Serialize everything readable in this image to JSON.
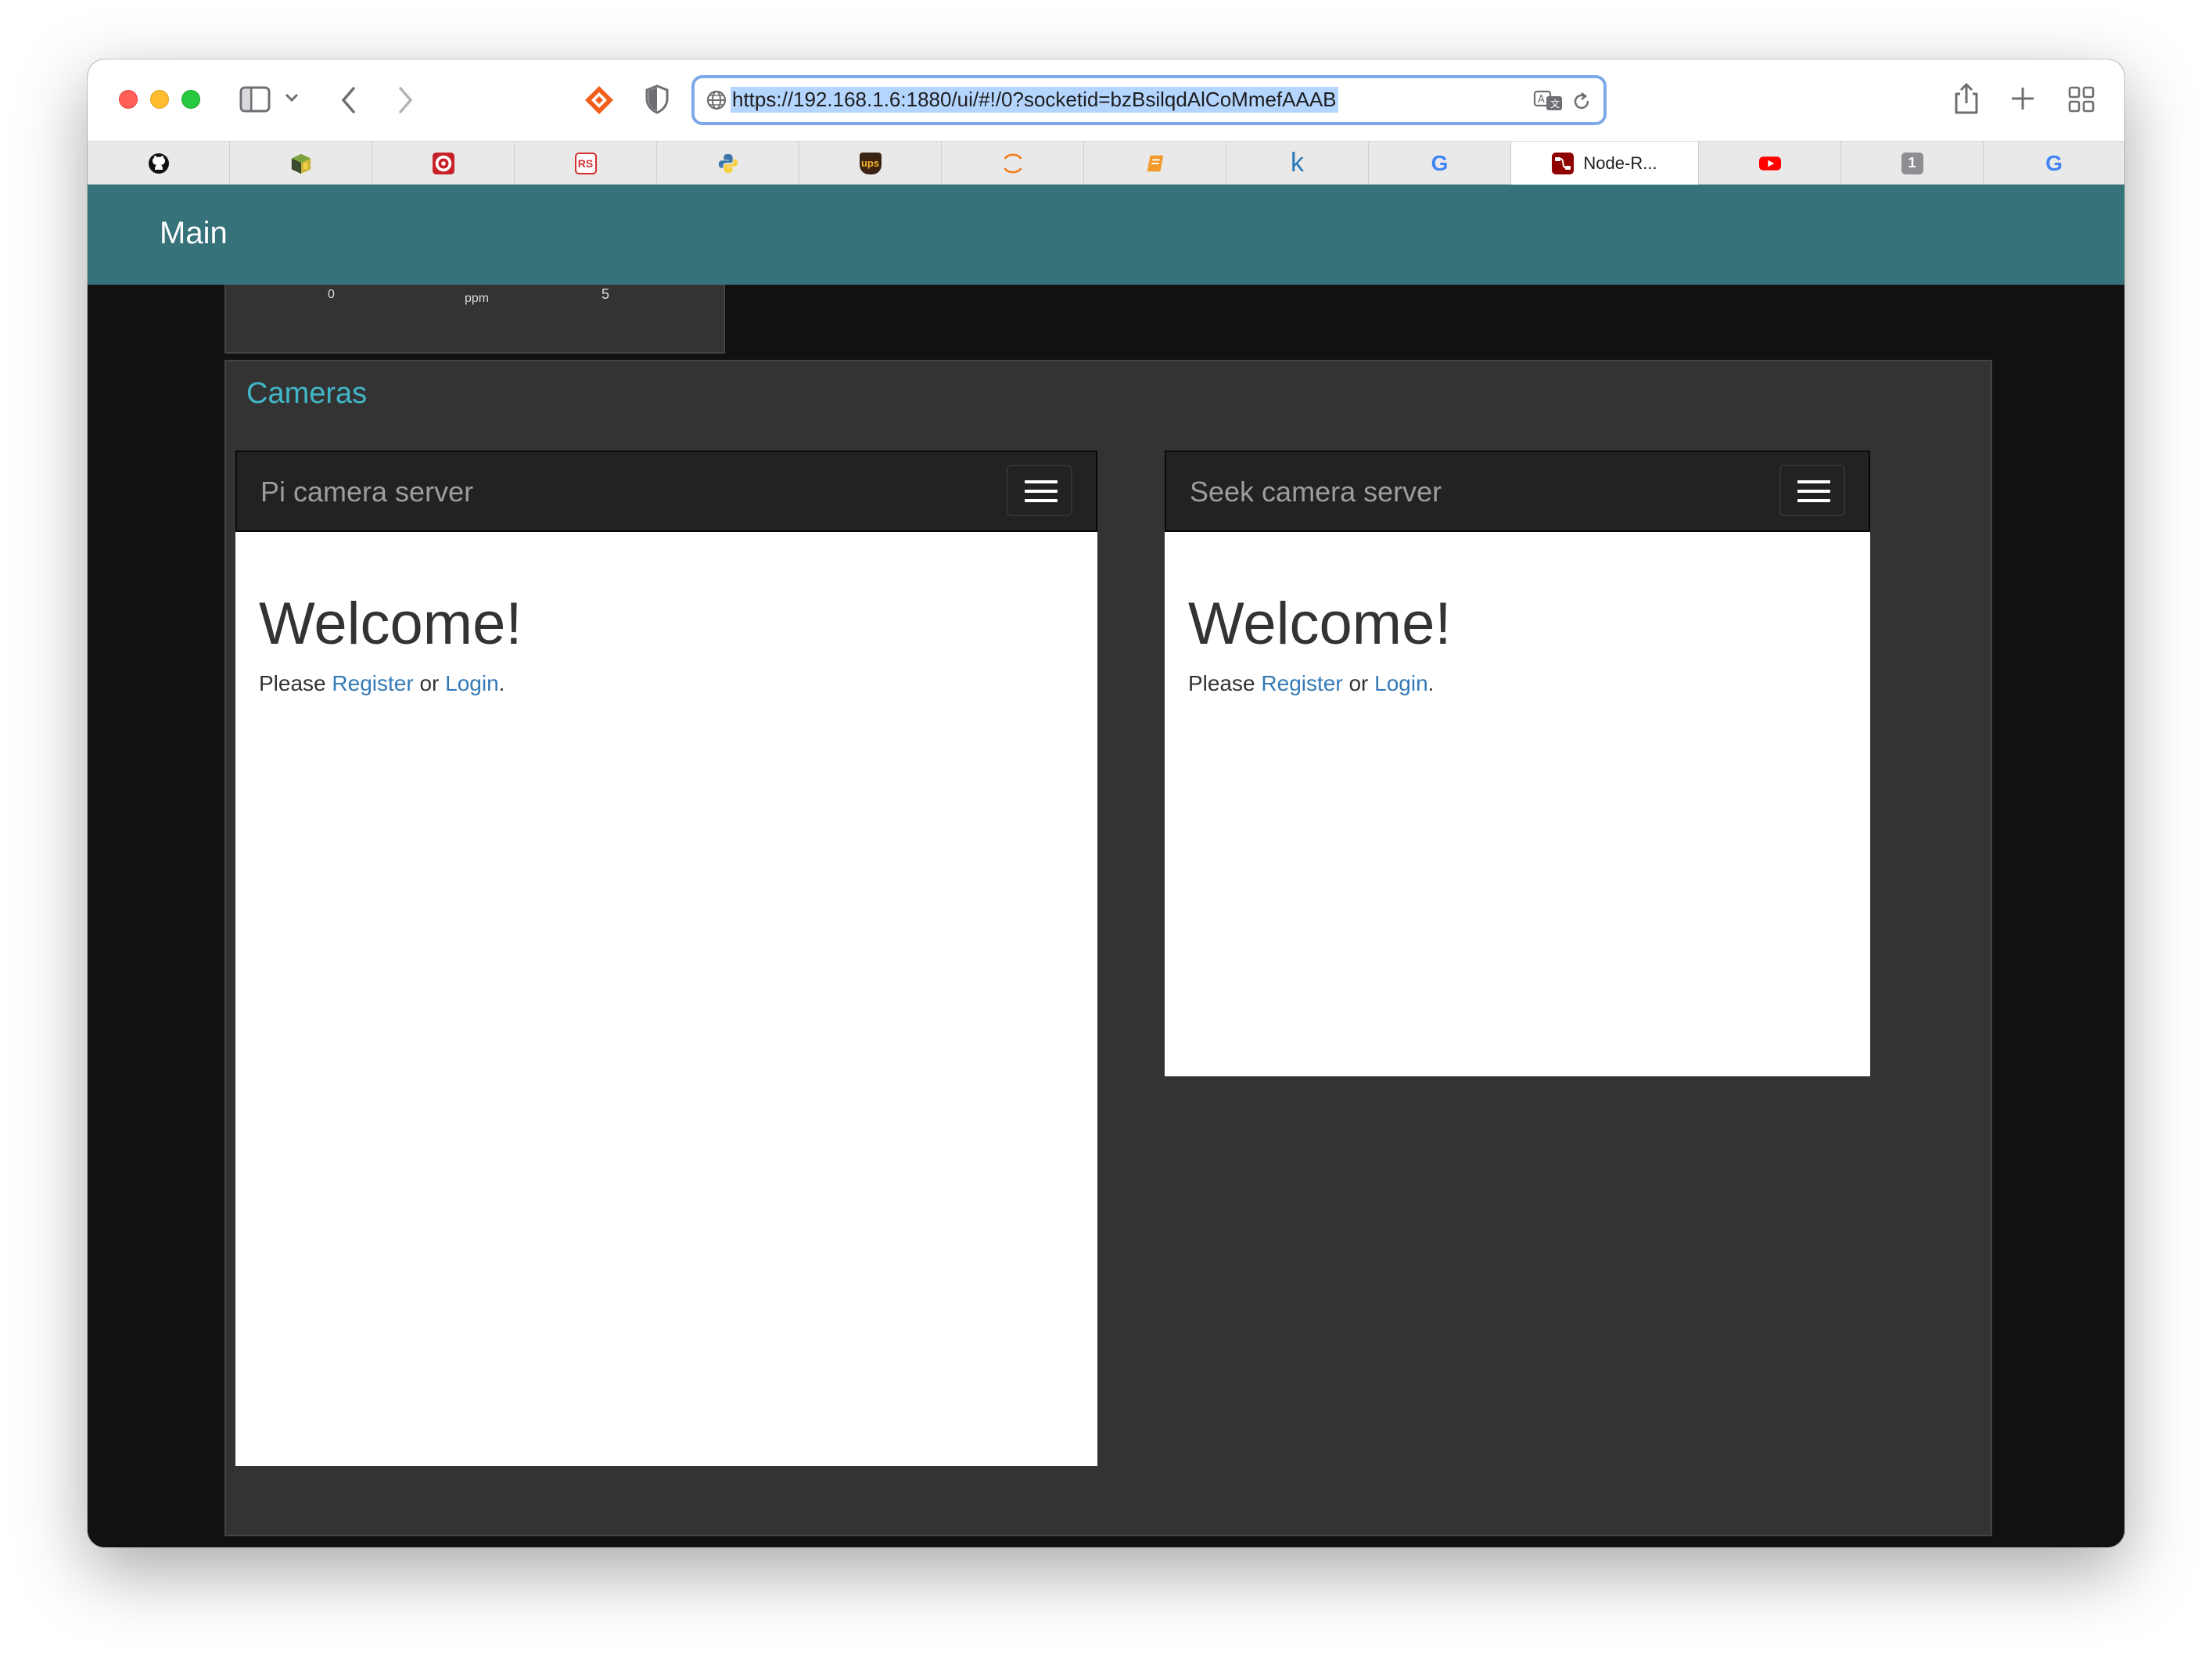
{
  "browser": {
    "url": "https://192.168.1.6:1880/ui/#!/0?socketid=bzBsilqdAlCoMmefAAAB",
    "tabs": [
      {
        "icon": "github-icon"
      },
      {
        "icon": "package-icon"
      },
      {
        "icon": "target-icon"
      },
      {
        "icon": "rs-icon",
        "glyph": "RS"
      },
      {
        "icon": "python-icon"
      },
      {
        "icon": "ups-icon",
        "glyph": "ups"
      },
      {
        "icon": "arc-icon"
      },
      {
        "icon": "book-icon"
      },
      {
        "icon": "k-icon",
        "glyph": "k"
      },
      {
        "icon": "google-icon",
        "glyph": "G"
      },
      {
        "icon": "node-red-icon",
        "label": "Node-R...",
        "active": true
      },
      {
        "icon": "youtube-icon"
      },
      {
        "icon": "badge-one-icon",
        "glyph": "1"
      },
      {
        "icon": "google-icon",
        "glyph": "G"
      }
    ]
  },
  "dashboard": {
    "title": "Main",
    "gauge": {
      "min": "0",
      "unit": "ppm",
      "max": "5"
    },
    "group_title": "Cameras",
    "cameras": [
      {
        "brand": "Pi camera server",
        "heading": "Welcome!",
        "text_before": "Please ",
        "register": "Register",
        "text_mid": " or ",
        "login": "Login",
        "text_after": "."
      },
      {
        "brand": "Seek camera server",
        "heading": "Welcome!",
        "text_before": "Please ",
        "register": "Register",
        "text_mid": " or ",
        "login": "Login",
        "text_after": "."
      }
    ]
  },
  "colors": {
    "header": "#36727a",
    "group_title": "#41b6c8",
    "link": "#337ab7",
    "url_highlight": "#b4d5fe"
  }
}
